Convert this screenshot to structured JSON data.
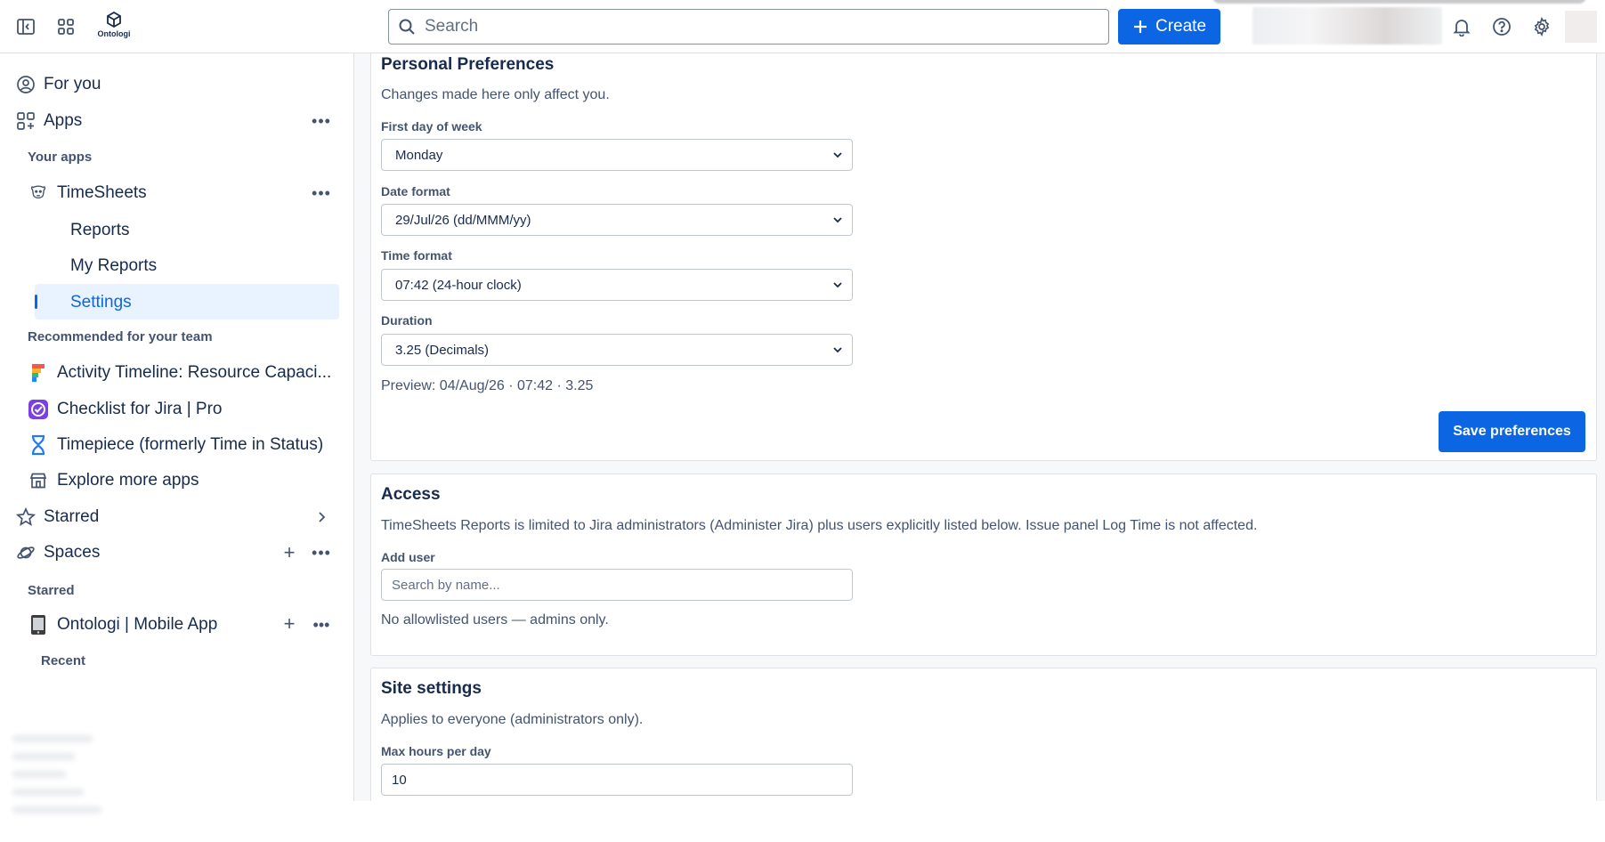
{
  "topbar": {
    "brand": "Ontologi",
    "search_placeholder": "Search",
    "create_label": "Create",
    "icons": [
      "sidebar-toggle-icon",
      "app-switcher-icon",
      "ontologi-logo",
      "search-icon",
      "plus-icon",
      "bell-icon",
      "help-icon",
      "gear-icon"
    ]
  },
  "sidebar": {
    "for_you": "For you",
    "apps": "Apps",
    "your_apps": "Your apps",
    "timesheets": "TimeSheets",
    "sub_items": [
      "Reports",
      "My Reports",
      "Settings"
    ],
    "recommended": "Recommended for your team",
    "recommended_apps": [
      "Activity Timeline: Resource Capaci...",
      "Checklist for Jira | Pro",
      "Timepiece (formerly Time in Status)",
      "Explore more apps"
    ],
    "starred": "Starred",
    "spaces": "Spaces",
    "starred_section": "Starred",
    "space_item": "Ontologi | Mobile App",
    "recent": "Recent"
  },
  "preferences": {
    "title": "Personal Preferences",
    "subtitle": "Changes made here only affect you.",
    "first_day_label": "First day of week",
    "first_day_value": "Monday",
    "date_format_label": "Date format",
    "date_format_value": "29/Jul/26 (dd/MMM/yy)",
    "time_format_label": "Time format",
    "time_format_value": "07:42 (24-hour clock)",
    "duration_label": "Duration",
    "duration_value": "3.25 (Decimals)",
    "preview": "Preview: 04/Aug/26 · 07:42 · 3.25",
    "save_label": "Save preferences"
  },
  "access": {
    "title": "Access",
    "description": "TimeSheets Reports is limited to Jira administrators (Administer Jira) plus users explicitly listed below. Issue panel Log Time is not affected.",
    "add_user_label": "Add user",
    "add_user_placeholder": "Search by name...",
    "empty_text": "No allowlisted users — admins only."
  },
  "site": {
    "title": "Site settings",
    "subtitle": "Applies to everyone (administrators only).",
    "max_hours_label": "Max hours per day",
    "max_hours_value": "10"
  },
  "colors": {
    "accent": "#0c66e4",
    "active_bg": "#e9f2ff",
    "text": "#172b4d",
    "muted": "#44546f"
  }
}
